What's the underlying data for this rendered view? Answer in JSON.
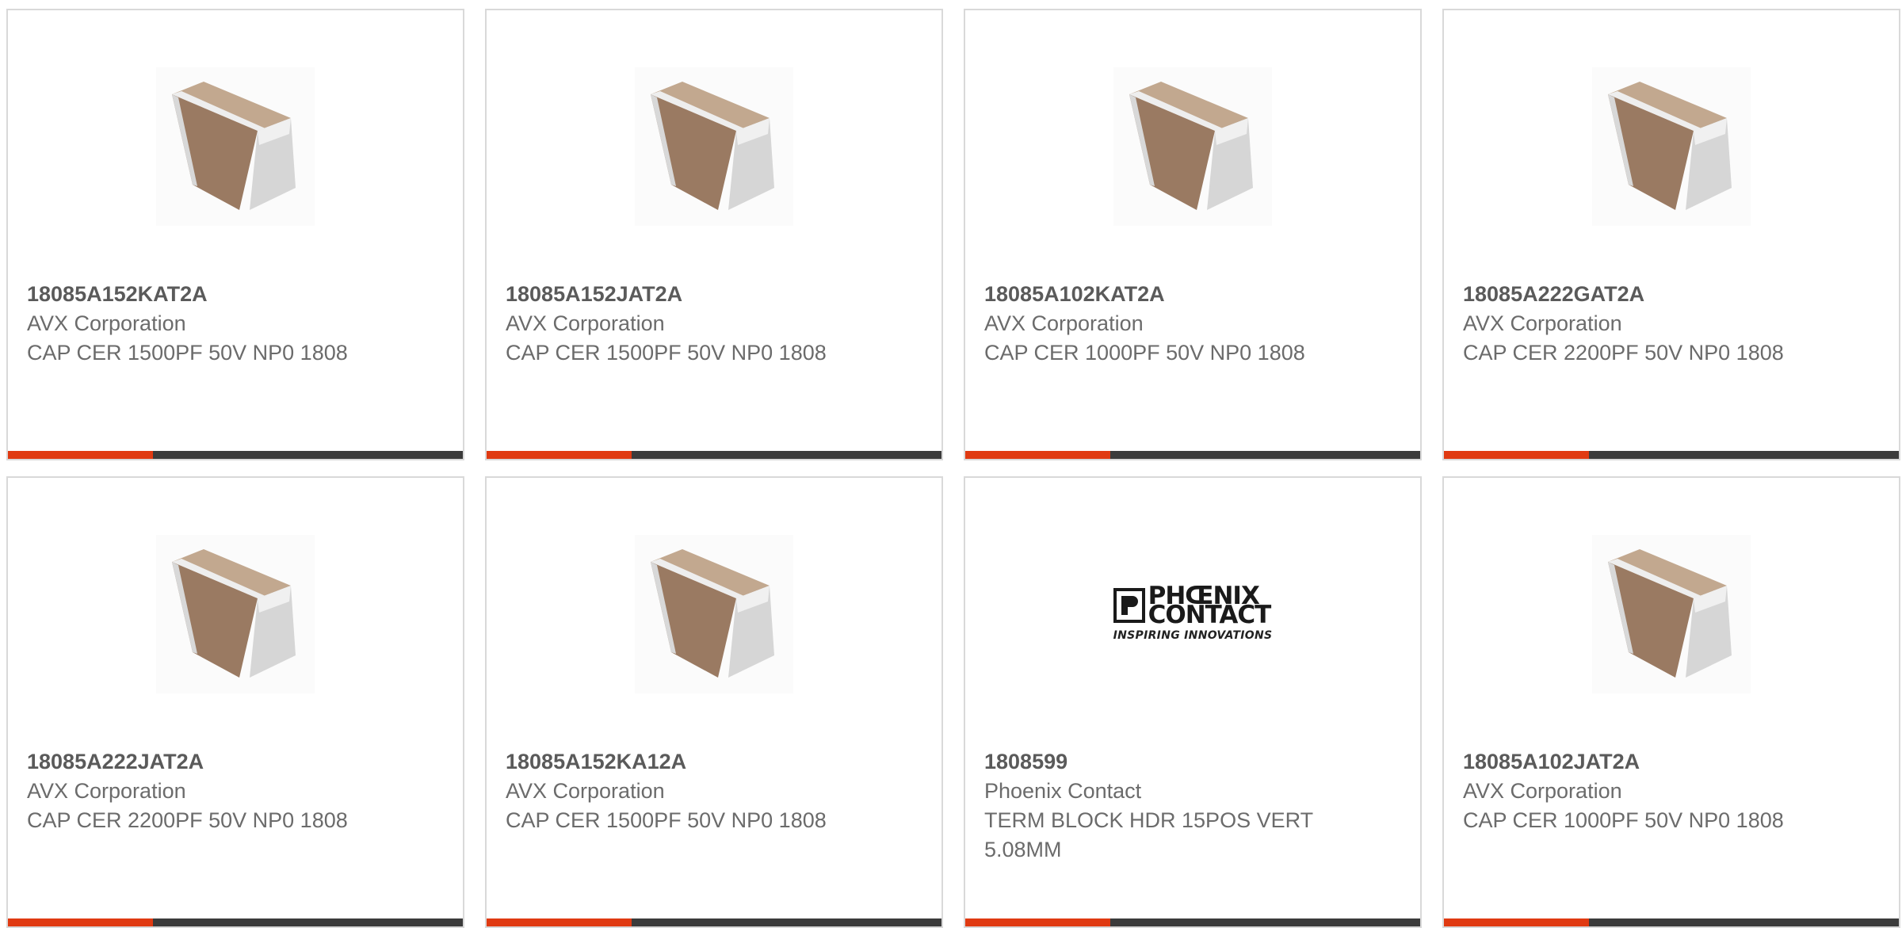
{
  "products": [
    {
      "part_number": "18085A152KAT2A",
      "manufacturer": "AVX Corporation",
      "description": "CAP CER 1500PF 50V NP0 1808",
      "image": "capacitor-chip"
    },
    {
      "part_number": "18085A152JAT2A",
      "manufacturer": "AVX Corporation",
      "description": "CAP CER 1500PF 50V NP0 1808",
      "image": "capacitor-chip"
    },
    {
      "part_number": "18085A102KAT2A",
      "manufacturer": "AVX Corporation",
      "description": "CAP CER 1000PF 50V NP0 1808",
      "image": "capacitor-chip"
    },
    {
      "part_number": "18085A222GAT2A",
      "manufacturer": "AVX Corporation",
      "description": "CAP CER 2200PF 50V NP0 1808",
      "image": "capacitor-chip"
    },
    {
      "part_number": "18085A222JAT2A",
      "manufacturer": "AVX Corporation",
      "description": "CAP CER 2200PF 50V NP0 1808",
      "image": "capacitor-chip"
    },
    {
      "part_number": "18085A152KA12A",
      "manufacturer": "AVX Corporation",
      "description": "CAP CER 1500PF 50V NP0 1808",
      "image": "capacitor-chip"
    },
    {
      "part_number": "1808599",
      "manufacturer": "Phoenix Contact",
      "description": "TERM BLOCK HDR 15POS VERT 5.08MM",
      "image": "phoenix-contact-logo",
      "logo": {
        "line1": "PHŒNIX",
        "line2": "CONTACT",
        "tagline": "INSPIRING INNOVATIONS"
      }
    },
    {
      "part_number": "18085A102JAT2A",
      "manufacturer": "AVX Corporation",
      "description": "CAP CER 1000PF 50V NP0 1808",
      "image": "capacitor-chip"
    }
  ],
  "colors": {
    "accent": "#e03a12",
    "bar": "#3b3b3b",
    "border": "#d9d9d9",
    "text": "#6b6b6b"
  }
}
